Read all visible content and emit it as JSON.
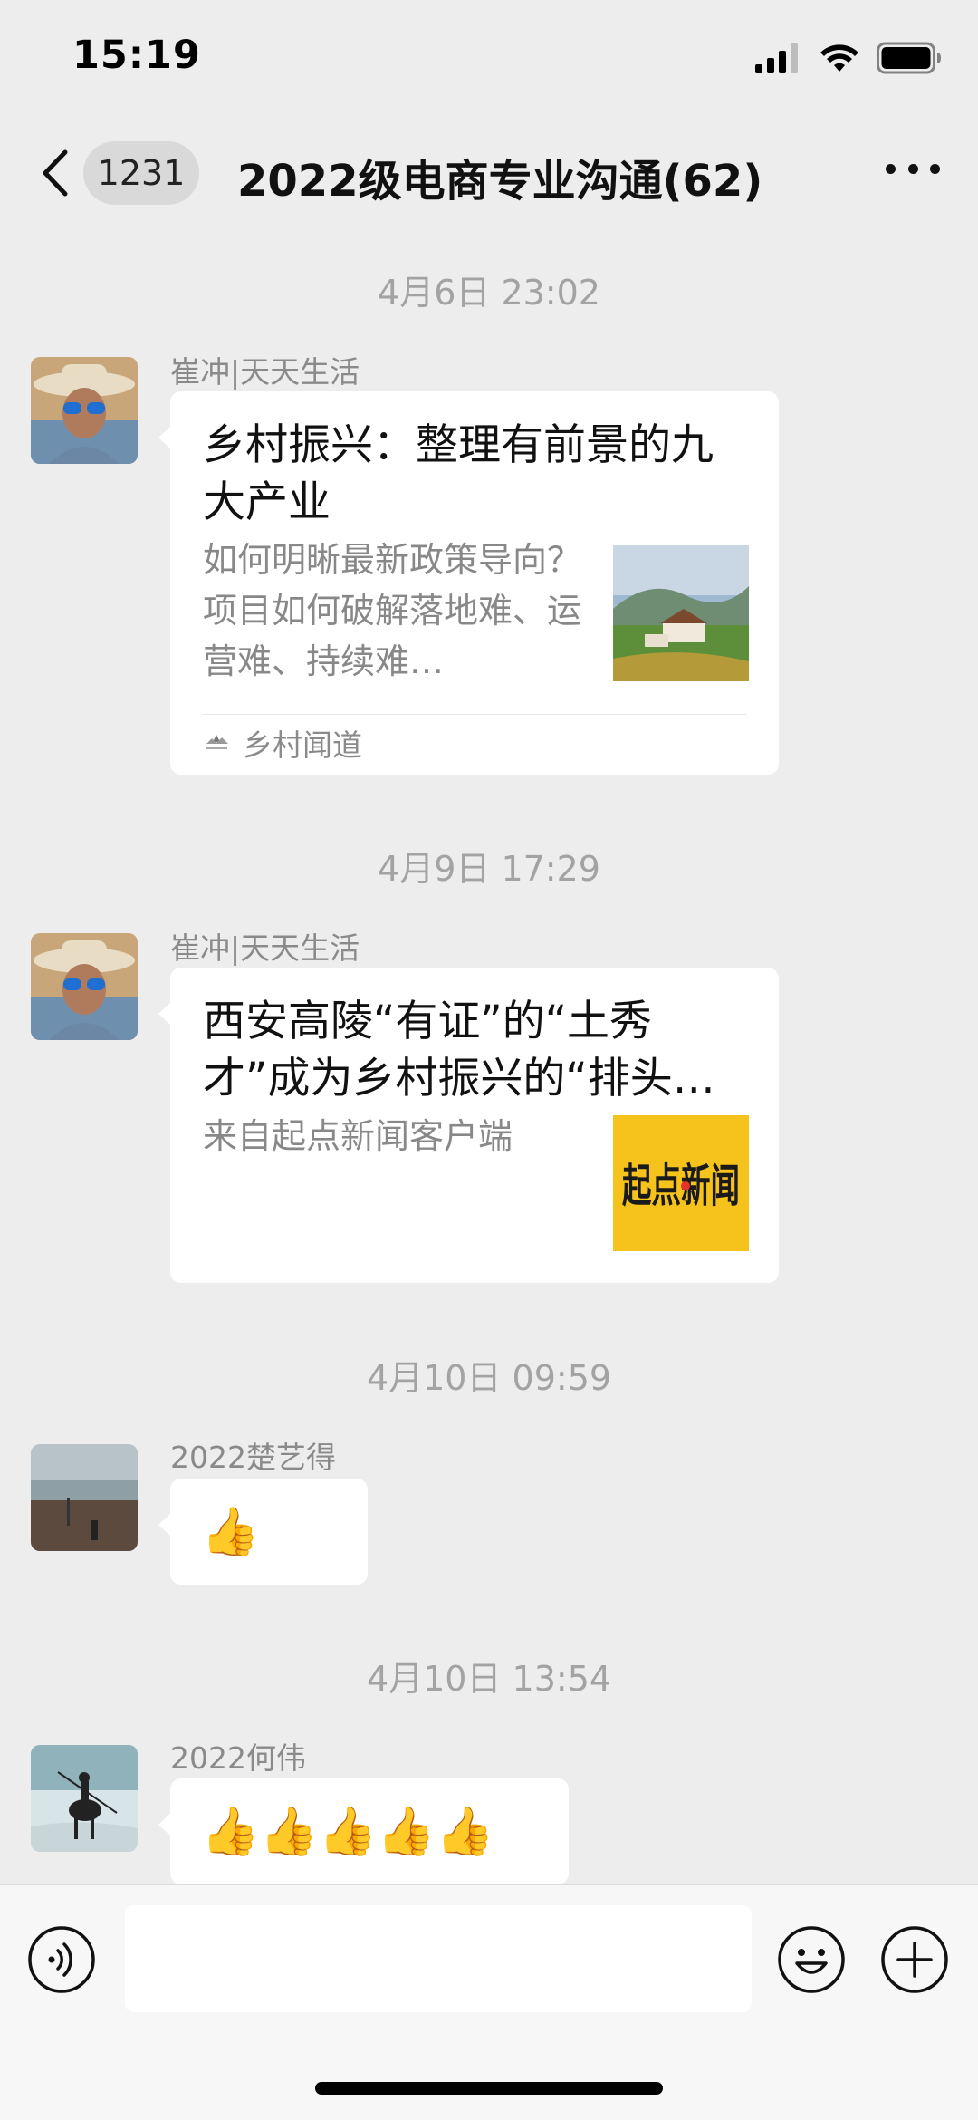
{
  "status": {
    "time": "15:19"
  },
  "nav": {
    "unread": "1231",
    "title": "2022级电商专业沟通(62)"
  },
  "messages": [
    {
      "timestamp": "4月6日 23:02",
      "sender": "崔冲|天天生活",
      "type": "article",
      "title": "乡村振兴：整理有前景的九大产业",
      "desc": "如何明晰最新政策导向？项目如何破解落地难、运营难、持续难…",
      "source": "乡村闻道"
    },
    {
      "timestamp": "4月9日 17:29",
      "sender": "崔冲|天天生活",
      "type": "link",
      "title": "西安高陵“有证”的“土秀才”成为乡村振兴的“排头…",
      "desc": "来自起点新闻客户端",
      "thumb_text": "起点新闻"
    },
    {
      "timestamp": "4月10日 09:59",
      "sender": "2022楚艺得",
      "type": "emoji",
      "content": "👍"
    },
    {
      "timestamp": "4月10日 13:54",
      "sender": "2022何伟",
      "type": "emoji",
      "content": "👍👍👍👍👍"
    }
  ],
  "input": {
    "value": ""
  },
  "colors": {
    "background": "#ededed",
    "bubble": "#ffffff",
    "muted": "#a3a3a3",
    "thumb_yellow": "#f6c21c"
  }
}
